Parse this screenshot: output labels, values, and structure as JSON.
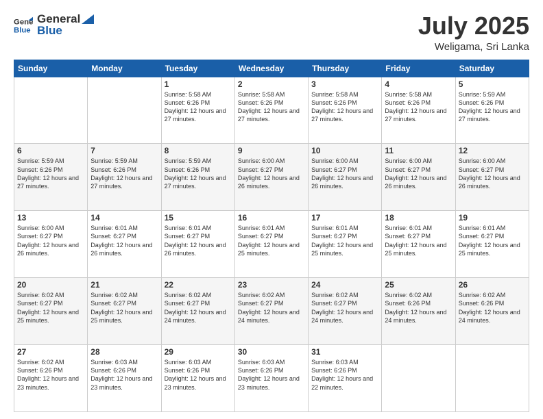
{
  "header": {
    "logo_line1": "General",
    "logo_line2": "Blue",
    "month_title": "July 2025",
    "location": "Weligama, Sri Lanka"
  },
  "days_of_week": [
    "Sunday",
    "Monday",
    "Tuesday",
    "Wednesday",
    "Thursday",
    "Friday",
    "Saturday"
  ],
  "weeks": [
    [
      {
        "day": "",
        "info": ""
      },
      {
        "day": "",
        "info": ""
      },
      {
        "day": "1",
        "info": "Sunrise: 5:58 AM\nSunset: 6:26 PM\nDaylight: 12 hours and 27 minutes."
      },
      {
        "day": "2",
        "info": "Sunrise: 5:58 AM\nSunset: 6:26 PM\nDaylight: 12 hours and 27 minutes."
      },
      {
        "day": "3",
        "info": "Sunrise: 5:58 AM\nSunset: 6:26 PM\nDaylight: 12 hours and 27 minutes."
      },
      {
        "day": "4",
        "info": "Sunrise: 5:58 AM\nSunset: 6:26 PM\nDaylight: 12 hours and 27 minutes."
      },
      {
        "day": "5",
        "info": "Sunrise: 5:59 AM\nSunset: 6:26 PM\nDaylight: 12 hours and 27 minutes."
      }
    ],
    [
      {
        "day": "6",
        "info": "Sunrise: 5:59 AM\nSunset: 6:26 PM\nDaylight: 12 hours and 27 minutes."
      },
      {
        "day": "7",
        "info": "Sunrise: 5:59 AM\nSunset: 6:26 PM\nDaylight: 12 hours and 27 minutes."
      },
      {
        "day": "8",
        "info": "Sunrise: 5:59 AM\nSunset: 6:26 PM\nDaylight: 12 hours and 27 minutes."
      },
      {
        "day": "9",
        "info": "Sunrise: 6:00 AM\nSunset: 6:27 PM\nDaylight: 12 hours and 26 minutes."
      },
      {
        "day": "10",
        "info": "Sunrise: 6:00 AM\nSunset: 6:27 PM\nDaylight: 12 hours and 26 minutes."
      },
      {
        "day": "11",
        "info": "Sunrise: 6:00 AM\nSunset: 6:27 PM\nDaylight: 12 hours and 26 minutes."
      },
      {
        "day": "12",
        "info": "Sunrise: 6:00 AM\nSunset: 6:27 PM\nDaylight: 12 hours and 26 minutes."
      }
    ],
    [
      {
        "day": "13",
        "info": "Sunrise: 6:00 AM\nSunset: 6:27 PM\nDaylight: 12 hours and 26 minutes."
      },
      {
        "day": "14",
        "info": "Sunrise: 6:01 AM\nSunset: 6:27 PM\nDaylight: 12 hours and 26 minutes."
      },
      {
        "day": "15",
        "info": "Sunrise: 6:01 AM\nSunset: 6:27 PM\nDaylight: 12 hours and 26 minutes."
      },
      {
        "day": "16",
        "info": "Sunrise: 6:01 AM\nSunset: 6:27 PM\nDaylight: 12 hours and 25 minutes."
      },
      {
        "day": "17",
        "info": "Sunrise: 6:01 AM\nSunset: 6:27 PM\nDaylight: 12 hours and 25 minutes."
      },
      {
        "day": "18",
        "info": "Sunrise: 6:01 AM\nSunset: 6:27 PM\nDaylight: 12 hours and 25 minutes."
      },
      {
        "day": "19",
        "info": "Sunrise: 6:01 AM\nSunset: 6:27 PM\nDaylight: 12 hours and 25 minutes."
      }
    ],
    [
      {
        "day": "20",
        "info": "Sunrise: 6:02 AM\nSunset: 6:27 PM\nDaylight: 12 hours and 25 minutes."
      },
      {
        "day": "21",
        "info": "Sunrise: 6:02 AM\nSunset: 6:27 PM\nDaylight: 12 hours and 25 minutes."
      },
      {
        "day": "22",
        "info": "Sunrise: 6:02 AM\nSunset: 6:27 PM\nDaylight: 12 hours and 24 minutes."
      },
      {
        "day": "23",
        "info": "Sunrise: 6:02 AM\nSunset: 6:27 PM\nDaylight: 12 hours and 24 minutes."
      },
      {
        "day": "24",
        "info": "Sunrise: 6:02 AM\nSunset: 6:27 PM\nDaylight: 12 hours and 24 minutes."
      },
      {
        "day": "25",
        "info": "Sunrise: 6:02 AM\nSunset: 6:26 PM\nDaylight: 12 hours and 24 minutes."
      },
      {
        "day": "26",
        "info": "Sunrise: 6:02 AM\nSunset: 6:26 PM\nDaylight: 12 hours and 24 minutes."
      }
    ],
    [
      {
        "day": "27",
        "info": "Sunrise: 6:02 AM\nSunset: 6:26 PM\nDaylight: 12 hours and 23 minutes."
      },
      {
        "day": "28",
        "info": "Sunrise: 6:03 AM\nSunset: 6:26 PM\nDaylight: 12 hours and 23 minutes."
      },
      {
        "day": "29",
        "info": "Sunrise: 6:03 AM\nSunset: 6:26 PM\nDaylight: 12 hours and 23 minutes."
      },
      {
        "day": "30",
        "info": "Sunrise: 6:03 AM\nSunset: 6:26 PM\nDaylight: 12 hours and 23 minutes."
      },
      {
        "day": "31",
        "info": "Sunrise: 6:03 AM\nSunset: 6:26 PM\nDaylight: 12 hours and 22 minutes."
      },
      {
        "day": "",
        "info": ""
      },
      {
        "day": "",
        "info": ""
      }
    ]
  ]
}
